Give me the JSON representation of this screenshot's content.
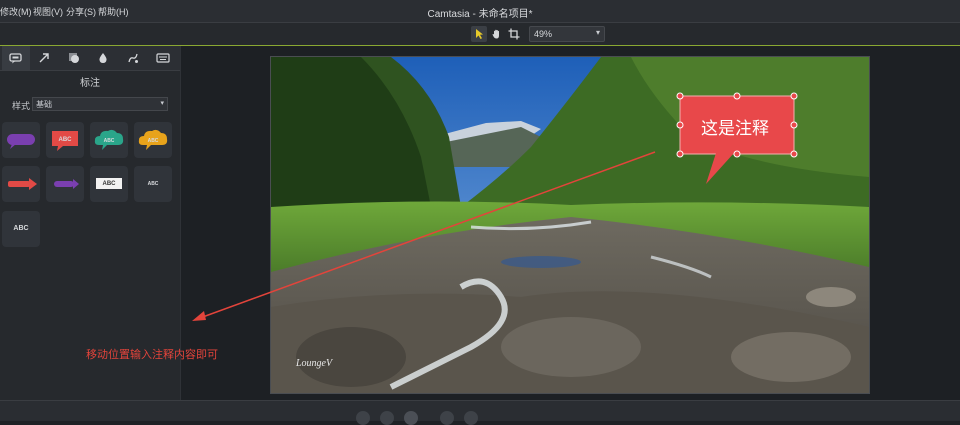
{
  "menubar": {
    "items": [
      {
        "label": "修改(M)"
      },
      {
        "label": "视图(V)"
      },
      {
        "label": "分享(S)"
      },
      {
        "label": "帮助(H)"
      }
    ],
    "title": "Camtasia - 未命名项目*"
  },
  "toolbar": {
    "tools": [
      "pointer-icon",
      "hand-icon",
      "crop-icon"
    ],
    "zoom": "49%"
  },
  "panel": {
    "tabs": [
      "callout-tab-icon",
      "arrow-tab-icon",
      "shape-tab-icon",
      "blur-tab-icon",
      "sketch-tab-icon",
      "keystroke-tab-icon"
    ],
    "title": "标注",
    "style_label": "样式",
    "style_value": "基础",
    "thumb_abc": "ABC"
  },
  "preview": {
    "callout_text": "这是注释",
    "watermark": "LoungeV"
  },
  "instruction": "移动位置输入注释内容即可",
  "colors": {
    "accent": "#8aa832",
    "callout_red": "#e8484a",
    "annotation_red": "#e3443b"
  }
}
